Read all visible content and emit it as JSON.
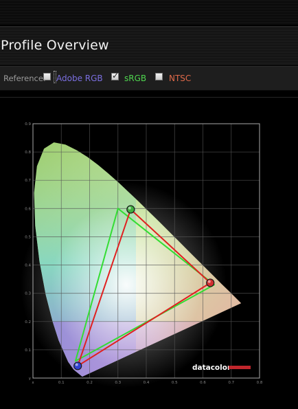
{
  "header": {
    "title": "Profile Overview"
  },
  "reference": {
    "label": "Reference:",
    "options": [
      {
        "label": "Adobe RGB",
        "checked": false,
        "color": "#7b6fe0"
      },
      {
        "label": "sRGB",
        "checked": true,
        "color": "#4fd64f"
      },
      {
        "label": "NTSC",
        "checked": false,
        "color": "#e06a4a"
      }
    ]
  },
  "chart_data": {
    "type": "scatter",
    "xlim": [
      0,
      0.8
    ],
    "ylim": [
      0,
      0.9
    ],
    "x_ticks": [
      "x",
      "0.1",
      "0.2",
      "0.3",
      "0.4",
      "0.5",
      "0.6",
      "0.7",
      "0.8"
    ],
    "y_ticks": [
      "y",
      "0.1",
      "0.2",
      "0.3",
      "0.4",
      "0.5",
      "0.6",
      "0.7",
      "0.8",
      "0.9"
    ],
    "grid": true,
    "series": [
      {
        "name": "sRGB",
        "color": "#33dd33",
        "points": [
          [
            0.64,
            0.33
          ],
          [
            0.3,
            0.6
          ],
          [
            0.15,
            0.06
          ]
        ]
      },
      {
        "color": "#e02020",
        "points": [
          [
            0.626,
            0.337
          ],
          [
            0.345,
            0.597
          ],
          [
            0.158,
            0.043
          ]
        ]
      }
    ],
    "markers": [
      {
        "x": 0.626,
        "y": 0.337,
        "color": "#d03030"
      },
      {
        "x": 0.345,
        "y": 0.597,
        "color": "#3fb03f"
      },
      {
        "x": 0.158,
        "y": 0.043,
        "color": "#3040d0"
      }
    ],
    "watermark": "datacolor"
  },
  "colors": {
    "background": "#000000",
    "grid": "#555555",
    "frame": "#aaaaaa"
  }
}
